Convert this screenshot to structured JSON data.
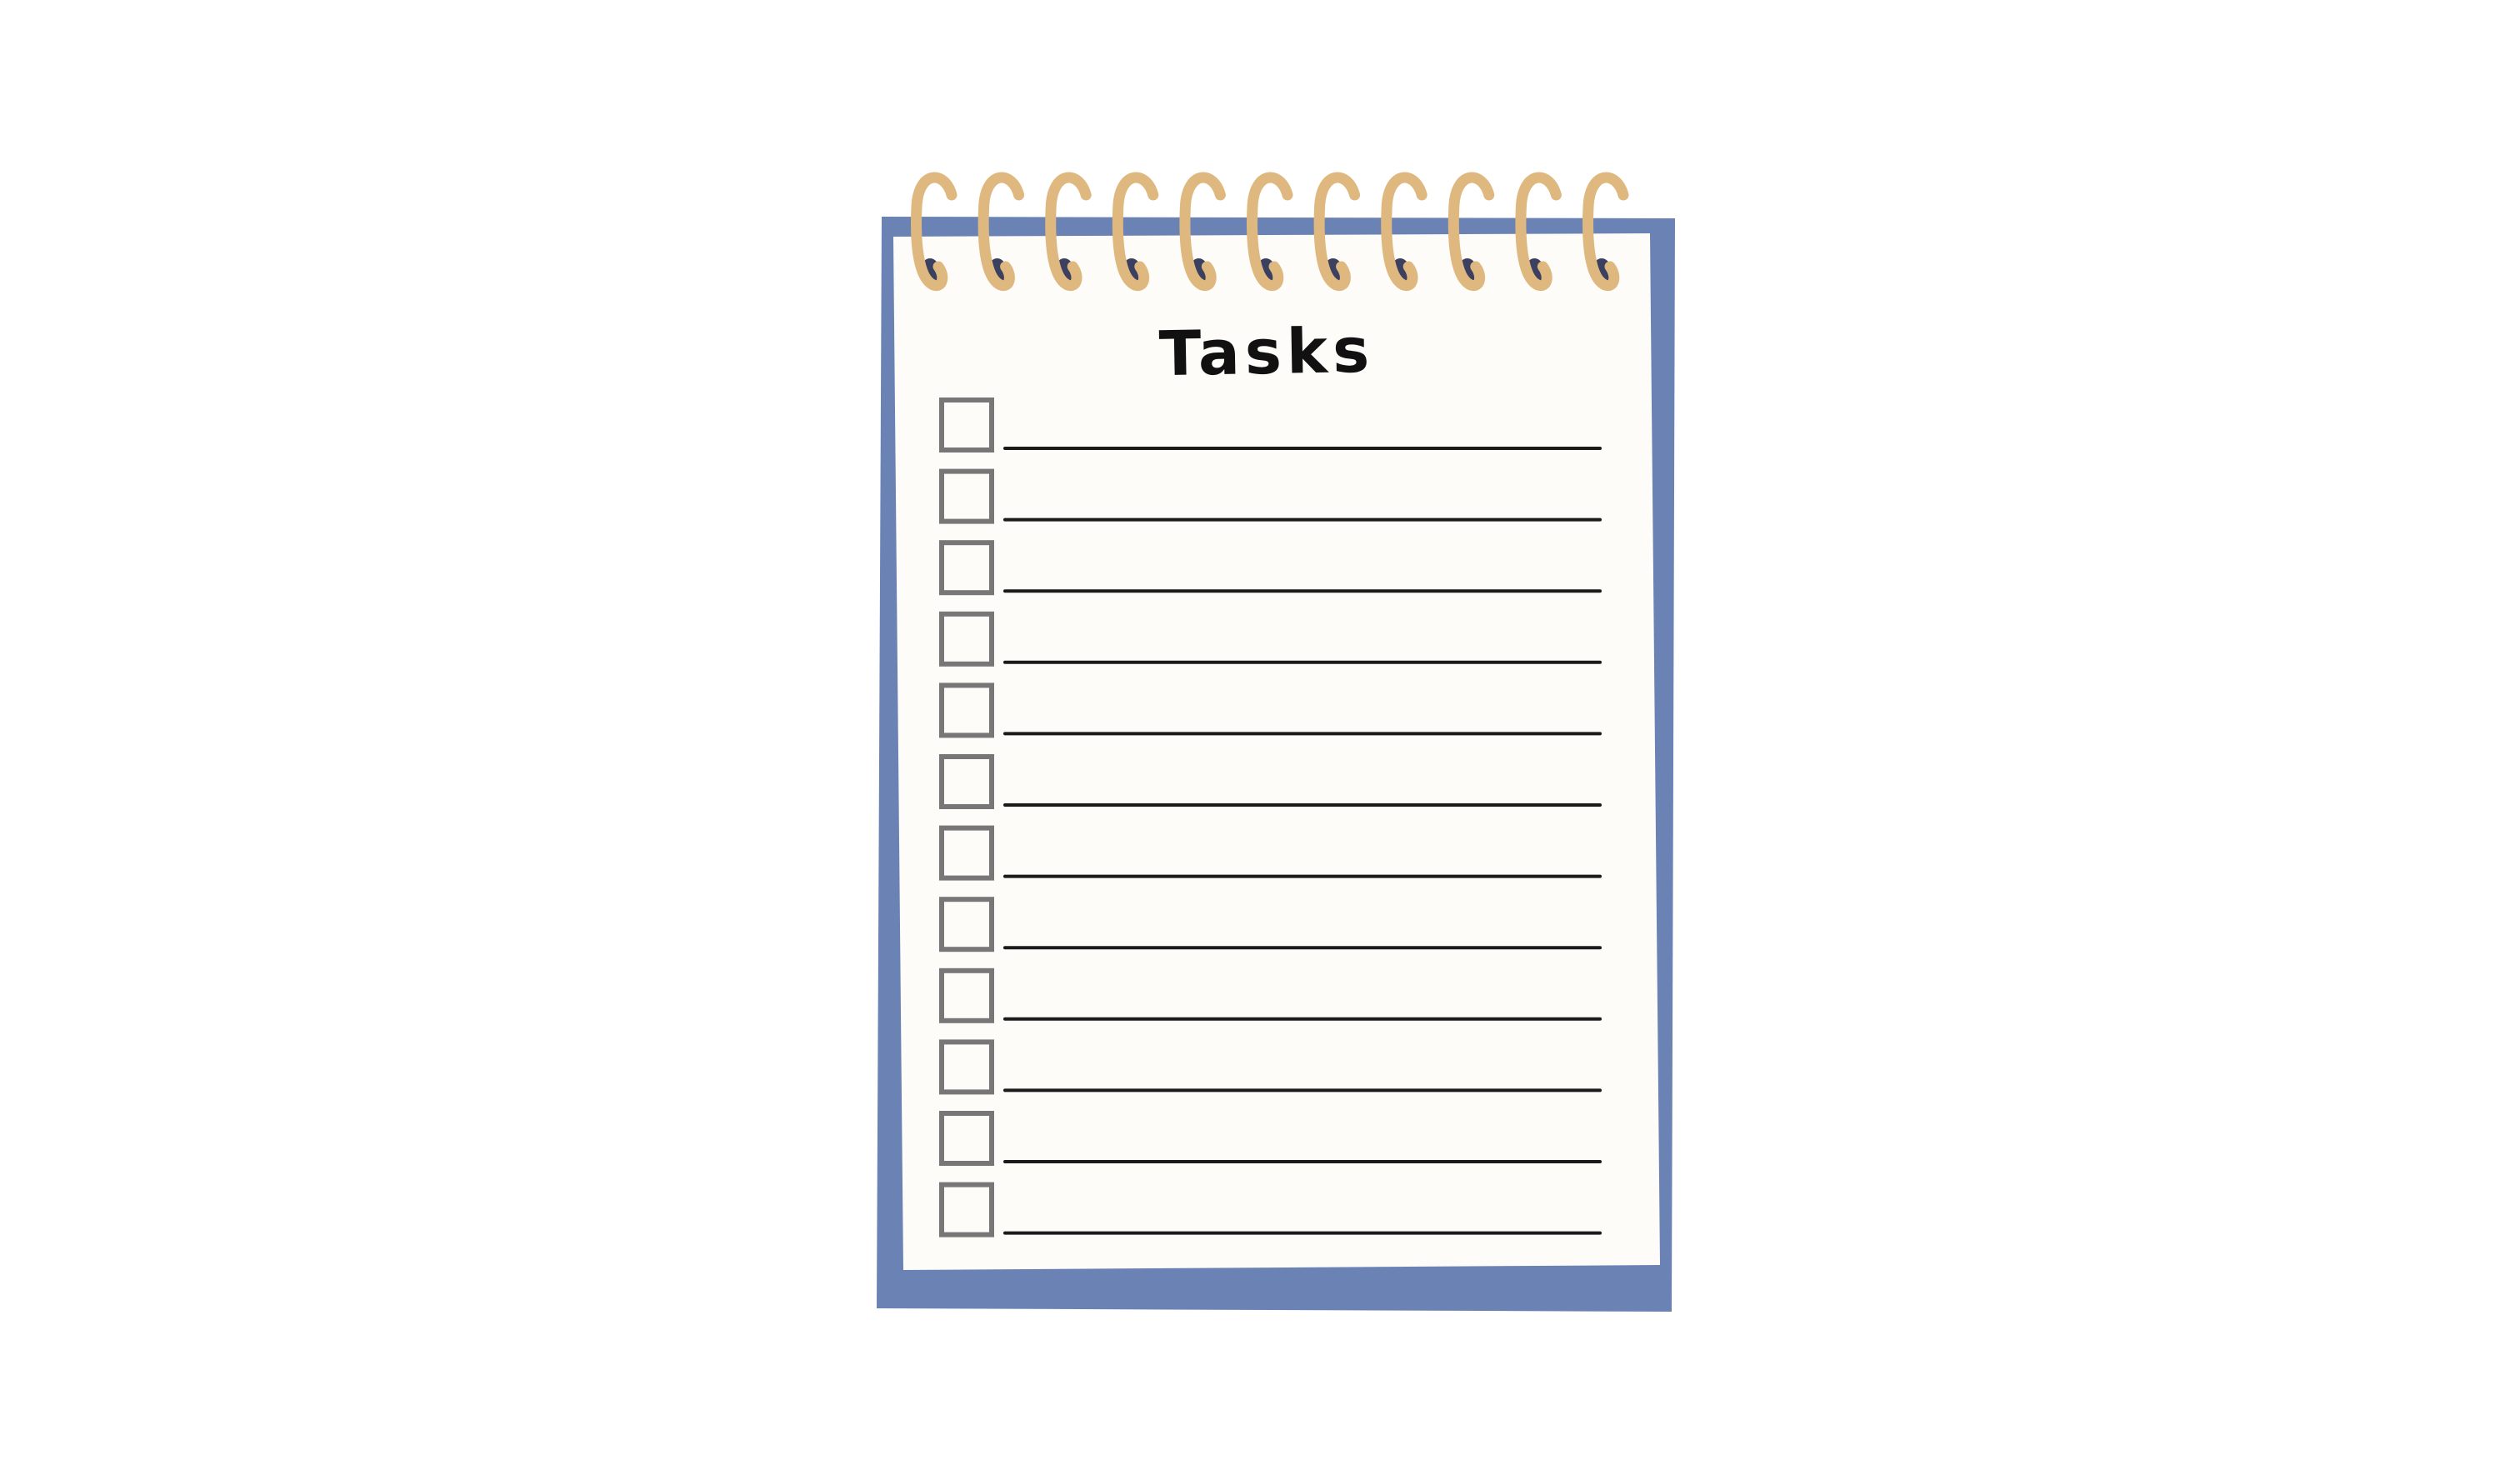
{
  "notepad": {
    "title": "Tasks",
    "task_count": 12,
    "ring_count": 11,
    "tasks": [
      {
        "checked": false,
        "text": ""
      },
      {
        "checked": false,
        "text": ""
      },
      {
        "checked": false,
        "text": ""
      },
      {
        "checked": false,
        "text": ""
      },
      {
        "checked": false,
        "text": ""
      },
      {
        "checked": false,
        "text": ""
      },
      {
        "checked": false,
        "text": ""
      },
      {
        "checked": false,
        "text": ""
      },
      {
        "checked": false,
        "text": ""
      },
      {
        "checked": false,
        "text": ""
      },
      {
        "checked": false,
        "text": ""
      },
      {
        "checked": false,
        "text": ""
      }
    ]
  },
  "colors": {
    "background": "#ffffff",
    "cover": "#6a83b4",
    "paper": "#fdfcf8",
    "ring": "#deb87e",
    "hole": "#3b4060",
    "checkbox_border": "#777777",
    "line": "#1a1a1a",
    "title": "#111111"
  },
  "icons": {
    "spiral": "spiral-ring-icon",
    "hole": "binding-hole-icon",
    "checkbox": "empty-checkbox-icon"
  }
}
